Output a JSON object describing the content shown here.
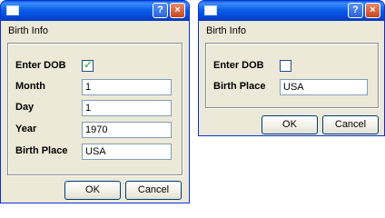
{
  "dialog_full": {
    "caption": "Birth Info",
    "title_buttons": {
      "help": "?",
      "close": "×"
    },
    "enter_dob": {
      "label": "Enter DOB",
      "checked": true,
      "check_mark": "✓"
    },
    "month": {
      "label": "Month",
      "value": "1"
    },
    "day": {
      "label": "Day",
      "value": "1"
    },
    "year": {
      "label": "Year",
      "value": "1970"
    },
    "birth_place": {
      "label": "Birth Place",
      "value": "USA"
    },
    "buttons": {
      "ok": "OK",
      "cancel": "Cancel"
    }
  },
  "dialog_compact": {
    "caption": "Birth Info",
    "title_buttons": {
      "help": "?",
      "close": "×"
    },
    "enter_dob": {
      "label": "Enter DOB",
      "checked": false
    },
    "birth_place": {
      "label": "Birth Place",
      "value": "USA"
    },
    "buttons": {
      "ok": "OK",
      "cancel": "Cancel"
    }
  },
  "colors": {
    "titlebar": "#0a5fe8",
    "dialog_bg": "#ece9d8",
    "close_button": "#c8451c",
    "checkbox_tick": "#21a121"
  }
}
